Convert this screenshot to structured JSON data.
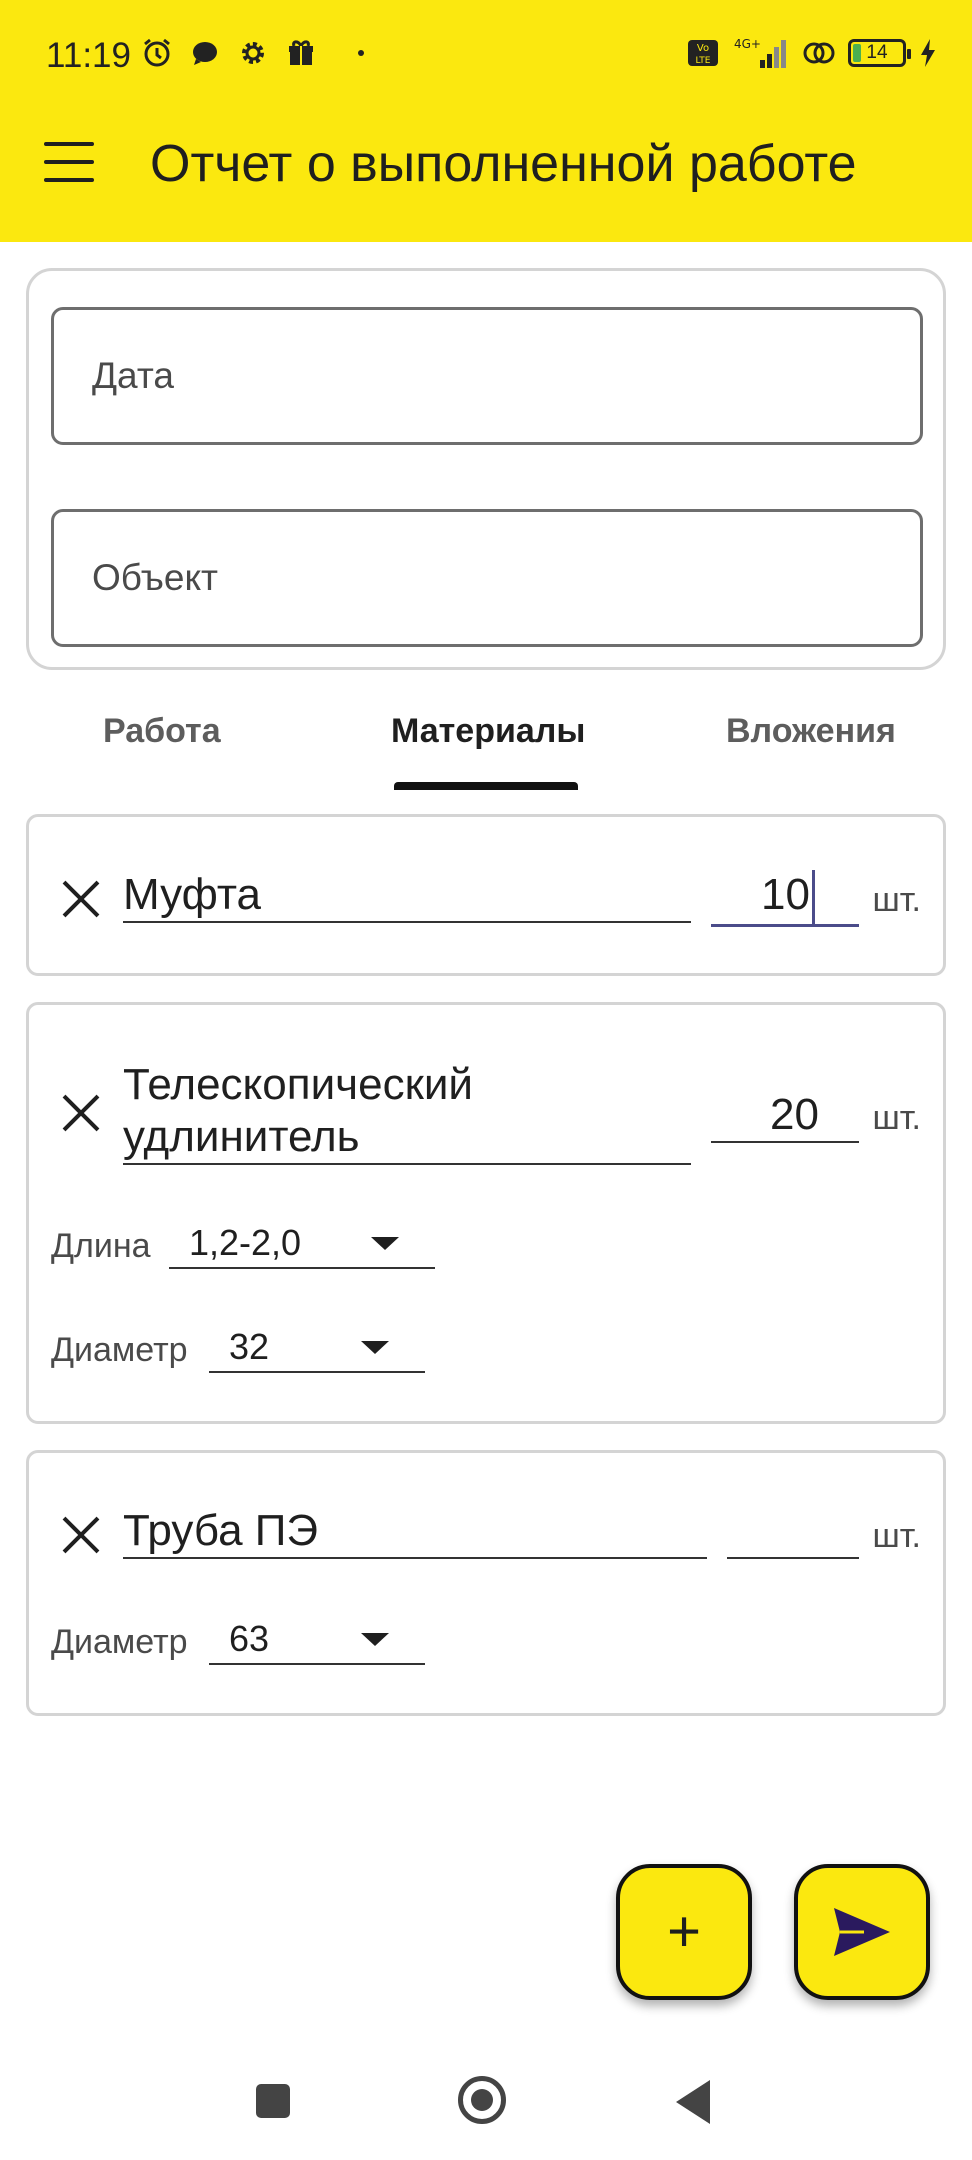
{
  "status_bar": {
    "time": "11:19",
    "battery": "14",
    "network": "4G+",
    "volte": "Vo LTE"
  },
  "app_bar": {
    "title": "Отчет о выполненной работе"
  },
  "form": {
    "date_placeholder": "Дата",
    "object_placeholder": "Объект"
  },
  "tabs": [
    {
      "label": "Работа",
      "active": false
    },
    {
      "label": "Материалы",
      "active": true
    },
    {
      "label": "Вложения",
      "active": false
    }
  ],
  "materials": [
    {
      "name": "Муфта",
      "quantity": "10",
      "unit": "шт."
    },
    {
      "name_line1": "Телескопический",
      "name_line2": "удлинитель",
      "quantity": "20",
      "unit": "шт.",
      "length_label": "Длина",
      "length_value": "1,2-2,0",
      "diameter_label": "Диаметр",
      "diameter_value": "32"
    },
    {
      "name": "Труба ПЭ",
      "quantity": "",
      "unit": "шт.",
      "diameter_label": "Диаметр",
      "diameter_value": "63"
    }
  ],
  "fab": {
    "add_label": "+"
  },
  "colors": {
    "accent": "#fbe80f",
    "send_icon": "#2a1a5e"
  }
}
